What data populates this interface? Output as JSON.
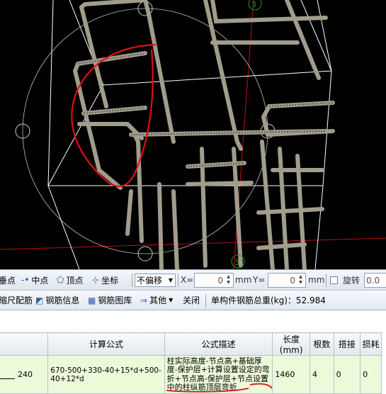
{
  "viewport": {
    "axis_labels": [
      "3",
      "3"
    ]
  },
  "snap_toolbar": {
    "perpendicular_label": "垂点",
    "midpoint_label": "中点",
    "vertex_label": "顶点",
    "coord_label": "坐标",
    "offset_mode": "不偏移",
    "x_label": "X=",
    "x_value": "0",
    "x_unit": "mm",
    "y_label": "Y=",
    "y_value": "0",
    "y_unit": "mm",
    "rotate_label": "旋转",
    "rotate_value": "0.0"
  },
  "rebar_toolbar": {
    "scale_rebar_label": "缩尺配筋",
    "rebar_info_label": "钢筋信息",
    "rebar_library_label": "钢筋图库",
    "other_label": "其他",
    "close_label": "关闭",
    "total_weight_label": "单构件钢筋总重(kg)：52.984"
  },
  "table": {
    "columns": [
      "",
      "计算公式",
      "公式描述",
      "长度(mm)",
      "根数",
      "搭接",
      "损耗"
    ],
    "rows": [
      {
        "shape_value": "240",
        "formula": "670-500+330-40+15*d+500-40+12*d",
        "description": "柱实际高度-节点高+基础厚度-保护层+计算设置设定的弯折+节点高-保护层+节点设置中的柱纵筋顶层弯折",
        "length": "1460",
        "count": "4",
        "lap": "0",
        "loss": "0"
      }
    ]
  },
  "colors": {
    "viewport_bg": "#000000",
    "rebar": "#a19c8c",
    "annotation": "#e01010",
    "row_highlight": "#ebfad9"
  }
}
